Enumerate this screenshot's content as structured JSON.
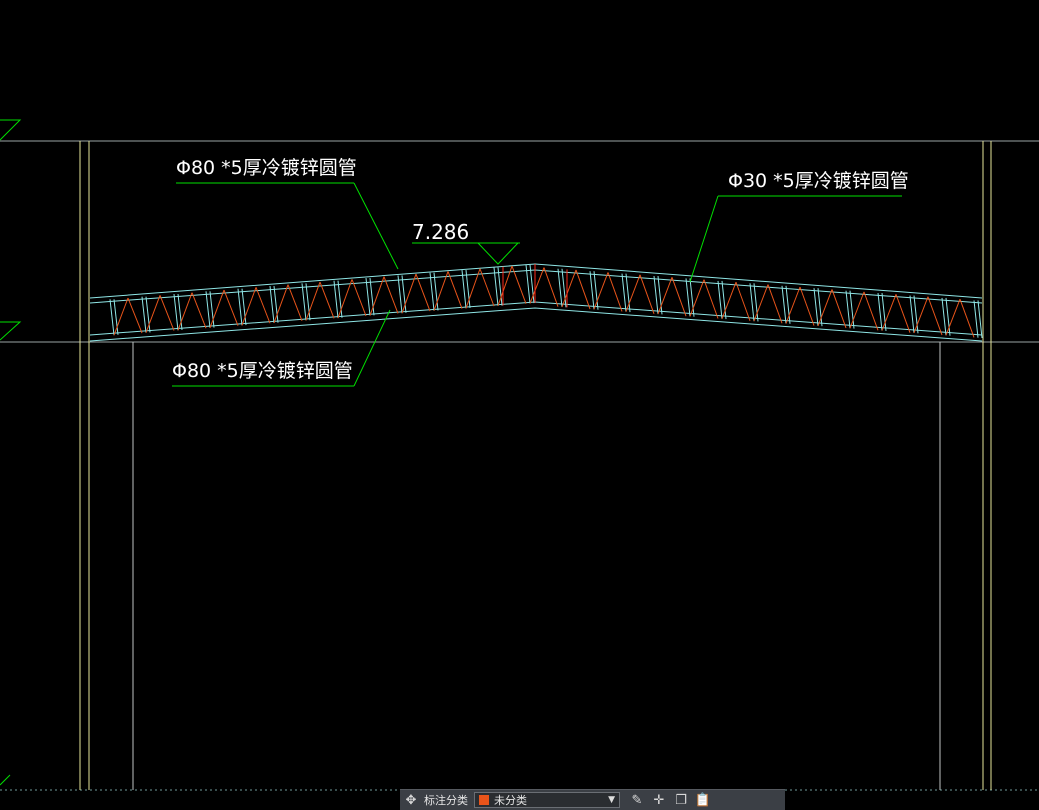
{
  "drawing": {
    "elevation_label": "7.286",
    "callouts": {
      "top_chord_left": "Φ80 *5厚冷镀锌圆管",
      "web_member": "Φ30 *5厚冷镀锌圆管",
      "bottom_chord_left": "Φ80 *5厚冷镀锌圆管"
    },
    "colors": {
      "background": "#000000",
      "axis_line": "#9aa3a3",
      "column_yellow": "#e6e69a",
      "chord_cyan": "#8fe6e6",
      "diagonal_red": "#e8541a",
      "leader_green": "#00e000",
      "text": "#ffffff"
    }
  },
  "toolbar": {
    "category_icon": "layers-icon",
    "category_label": "标注分类",
    "category_value": "未分类",
    "dropdown_icon": "chevron-down-icon",
    "edit_icon": "edit-icon",
    "move_icon": "move-icon",
    "copy_icon": "copy-icon",
    "paste_icon": "paste-icon"
  }
}
